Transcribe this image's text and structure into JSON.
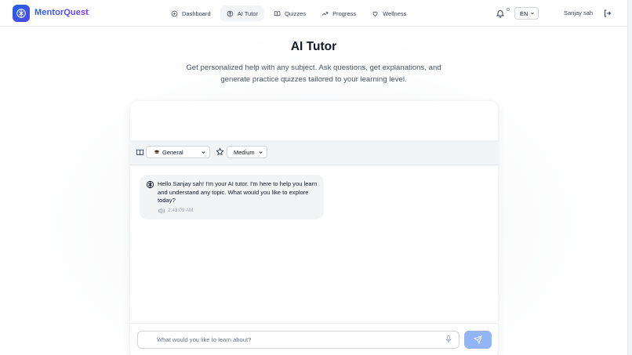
{
  "app": {
    "name": "MentorQuest"
  },
  "nav": {
    "items": [
      {
        "label": "Dashboard",
        "icon": "dashboard-icon",
        "active": false
      },
      {
        "label": "AI Tutor",
        "icon": "brain-icon",
        "active": true
      },
      {
        "label": "Quizzes",
        "icon": "book-icon",
        "active": false
      },
      {
        "label": "Progress",
        "icon": "trending-up-icon",
        "active": false
      },
      {
        "label": "Wellness",
        "icon": "heart-icon",
        "active": false
      }
    ]
  },
  "header": {
    "language": "EN",
    "user_name": "Sanjay sah"
  },
  "page": {
    "title": "AI Tutor",
    "subtitle": "Get personalized help with any subject. Ask questions, get explanations, and generate practice quizzes tailored to your learning level."
  },
  "toolbar": {
    "subject": "General",
    "difficulty": "Medium"
  },
  "messages": [
    {
      "text": "Hello Sanjay sah! I'm your AI tutor. I'm here to help you learn and understand any topic. What would you like to explore today?",
      "time": "2:43:09 AM"
    }
  ],
  "composer": {
    "placeholder": "What would you like to learn about?"
  },
  "colors": {
    "brand": "#2563eb",
    "send_button": "#93b4f5",
    "message_bg": "#f3f4f6"
  }
}
